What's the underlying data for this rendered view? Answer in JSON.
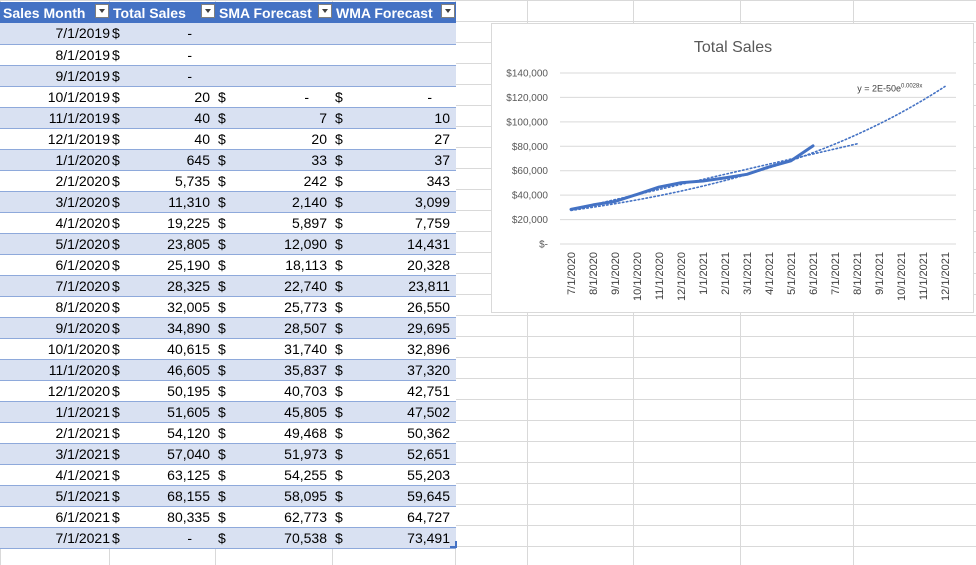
{
  "sheet": {
    "headers": [
      "Sales Month",
      "Total Sales",
      "SMA Forecast",
      "WMA Forecast"
    ],
    "currency_symbol": "$",
    "rows": [
      {
        "month": "7/1/2019",
        "total": "-",
        "sma": "",
        "wma": ""
      },
      {
        "month": "8/1/2019",
        "total": "-",
        "sma": "",
        "wma": ""
      },
      {
        "month": "9/1/2019",
        "total": "-",
        "sma": "",
        "wma": ""
      },
      {
        "month": "10/1/2019",
        "total": "20",
        "sma": "-",
        "wma": "-"
      },
      {
        "month": "11/1/2019",
        "total": "40",
        "sma": "7",
        "wma": "10"
      },
      {
        "month": "12/1/2019",
        "total": "40",
        "sma": "20",
        "wma": "27"
      },
      {
        "month": "1/1/2020",
        "total": "645",
        "sma": "33",
        "wma": "37"
      },
      {
        "month": "2/1/2020",
        "total": "5,735",
        "sma": "242",
        "wma": "343"
      },
      {
        "month": "3/1/2020",
        "total": "11,310",
        "sma": "2,140",
        "wma": "3,099"
      },
      {
        "month": "4/1/2020",
        "total": "19,225",
        "sma": "5,897",
        "wma": "7,759"
      },
      {
        "month": "5/1/2020",
        "total": "23,805",
        "sma": "12,090",
        "wma": "14,431"
      },
      {
        "month": "6/1/2020",
        "total": "25,190",
        "sma": "18,113",
        "wma": "20,328"
      },
      {
        "month": "7/1/2020",
        "total": "28,325",
        "sma": "22,740",
        "wma": "23,811"
      },
      {
        "month": "8/1/2020",
        "total": "32,005",
        "sma": "25,773",
        "wma": "26,550"
      },
      {
        "month": "9/1/2020",
        "total": "34,890",
        "sma": "28,507",
        "wma": "29,695"
      },
      {
        "month": "10/1/2020",
        "total": "40,615",
        "sma": "31,740",
        "wma": "32,896"
      },
      {
        "month": "11/1/2020",
        "total": "46,605",
        "sma": "35,837",
        "wma": "37,320"
      },
      {
        "month": "12/1/2020",
        "total": "50,195",
        "sma": "40,703",
        "wma": "42,751"
      },
      {
        "month": "1/1/2021",
        "total": "51,605",
        "sma": "45,805",
        "wma": "47,502"
      },
      {
        "month": "2/1/2021",
        "total": "54,120",
        "sma": "49,468",
        "wma": "50,362"
      },
      {
        "month": "3/1/2021",
        "total": "57,040",
        "sma": "51,973",
        "wma": "52,651"
      },
      {
        "month": "4/1/2021",
        "total": "63,125",
        "sma": "54,255",
        "wma": "55,203"
      },
      {
        "month": "5/1/2021",
        "total": "68,155",
        "sma": "58,095",
        "wma": "59,645"
      },
      {
        "month": "6/1/2021",
        "total": "80,335",
        "sma": "62,773",
        "wma": "64,727"
      },
      {
        "month": "7/1/2021",
        "total": "-",
        "sma": "70,538",
        "wma": "73,491"
      }
    ]
  },
  "chart_data": {
    "type": "line",
    "title": "Total Sales",
    "x": [
      "7/1/2020",
      "8/1/2020",
      "9/1/2020",
      "10/1/2020",
      "11/1/2020",
      "12/1/2020",
      "1/1/2021",
      "2/1/2021",
      "3/1/2021",
      "4/1/2021",
      "5/1/2021",
      "6/1/2021",
      "7/1/2021",
      "8/1/2021",
      "9/1/2021",
      "10/1/2021",
      "11/1/2021",
      "12/1/2021"
    ],
    "series": [
      {
        "values": [
          28325,
          32005,
          34890,
          40615,
          46605,
          50195,
          51605,
          54120,
          57040,
          63125,
          68155,
          80335
        ]
      }
    ],
    "trendlines": [
      {
        "kind": "exponential",
        "label": "y = 2E-50e",
        "label_exponent": "0.0028x",
        "start": 27500,
        "end": 129000,
        "extends_to": "12/1/2021"
      },
      {
        "kind": "linear",
        "start": 28000,
        "end": 82000,
        "extends_to": "8/1/2021"
      }
    ],
    "y_ticks": [
      "$-",
      "$20,000",
      "$40,000",
      "$60,000",
      "$80,000",
      "$100,000",
      "$120,000",
      "$140,000"
    ],
    "ylim": [
      0,
      140000
    ],
    "grid": true,
    "legend": "none",
    "colors": {
      "series": "#4472c4",
      "grid": "#d9d9d9",
      "text": "#595959"
    }
  },
  "colors": {
    "header_bg": "#4472c4",
    "band_odd": "#d9e1f2",
    "band_even": "#ffffff",
    "gridline": "#d9d9d9"
  }
}
